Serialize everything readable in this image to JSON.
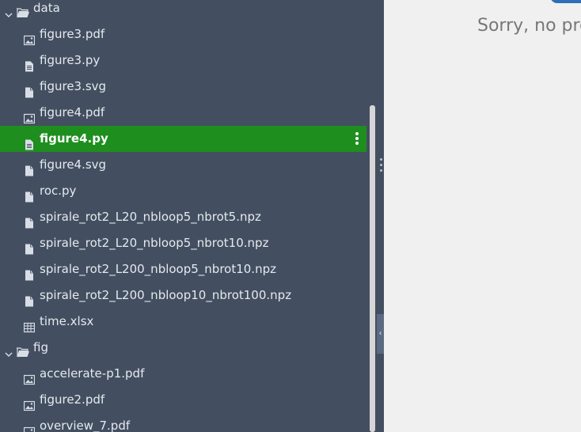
{
  "file_tree": {
    "rows": [
      {
        "kind": "folder",
        "label": "data",
        "icon": "folder-open-icon"
      },
      {
        "kind": "file",
        "label": "figure3.pdf",
        "icon": "image-file-icon"
      },
      {
        "kind": "file",
        "label": "figure3.py",
        "icon": "text-file-icon"
      },
      {
        "kind": "file",
        "label": "figure3.svg",
        "icon": "file-icon"
      },
      {
        "kind": "file",
        "label": "figure4.pdf",
        "icon": "image-file-icon"
      },
      {
        "kind": "file",
        "label": "figure4.py",
        "icon": "text-file-icon",
        "selected": true
      },
      {
        "kind": "file",
        "label": "figure4.svg",
        "icon": "file-icon"
      },
      {
        "kind": "file",
        "label": "roc.py",
        "icon": "file-icon"
      },
      {
        "kind": "file",
        "label": "spirale_rot2_L20_nbloop5_nbrot5.npz",
        "icon": "file-icon"
      },
      {
        "kind": "file",
        "label": "spirale_rot2_L20_nbloop5_nbrot10.npz",
        "icon": "file-icon"
      },
      {
        "kind": "file",
        "label": "spirale_rot2_L200_nbloop5_nbrot10.npz",
        "icon": "file-icon"
      },
      {
        "kind": "file",
        "label": "spirale_rot2_L200_nbloop10_nbrot100.npz",
        "icon": "file-icon"
      },
      {
        "kind": "file",
        "label": "time.xlsx",
        "icon": "table-file-icon"
      },
      {
        "kind": "folder",
        "label": "fig",
        "icon": "folder-open-icon"
      },
      {
        "kind": "file",
        "label": "accelerate-p1.pdf",
        "icon": "image-file-icon"
      },
      {
        "kind": "file",
        "label": "figure2.pdf",
        "icon": "image-file-icon"
      },
      {
        "kind": "file",
        "label": "overview_7.pdf",
        "icon": "image-file-icon"
      }
    ]
  },
  "preview": {
    "message": "Sorry, no pre"
  },
  "colors": {
    "sidebar_bg": "#434f61",
    "selected_bg": "#1e8e1e",
    "preview_bg": "#f0f0f0"
  }
}
